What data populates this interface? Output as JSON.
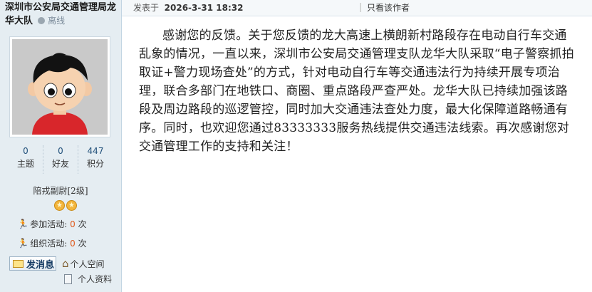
{
  "user": {
    "name": "深圳市公安局交通管理局龙华大队",
    "status": "离线"
  },
  "stats": [
    {
      "value": "0",
      "label": "主题"
    },
    {
      "value": "0",
      "label": "好友"
    },
    {
      "value": "447",
      "label": "积分"
    }
  ],
  "rank": "陪戎副尉[2级]",
  "rank_stars": 2,
  "activities": {
    "joined_label": "参加活动:",
    "joined_count": "0",
    "organized_label": "组织活动:",
    "organized_count": "0",
    "unit": "次"
  },
  "actions": {
    "message_button": "发消息",
    "space_link": "个人空间",
    "profile_link": "个人资料"
  },
  "post": {
    "posted_prefix": "发表于",
    "timestamp": "2026-3-31 18:32",
    "separator": "|",
    "author_only": "只看该作者",
    "content": "感谢您的反馈。关于您反馈的龙大高速上横朗新村路段存在电动自行车交通乱象的情况，一直以来，深圳市公安局交通管理支队龙华大队采取“电子警察抓拍取证+警力现场查处”的方式，针对电动自行车等交通违法行为持续开展专项治理，联合多部门在地铁口、商圈、重点路段严查严处。龙华大队已持续加强该路段及周边路段的巡逻管控，同时加大交通违法查处力度，最大化保障道路畅通有序。同时，也欢迎您通过83333333服务热线提供交通违法线索。再次感谢您对交通管理工作的支持和关注！"
  },
  "colors": {
    "sidebar_bg": "#e5edf2",
    "count_orange": "#e05a1b",
    "link_blue": "#21507a"
  }
}
